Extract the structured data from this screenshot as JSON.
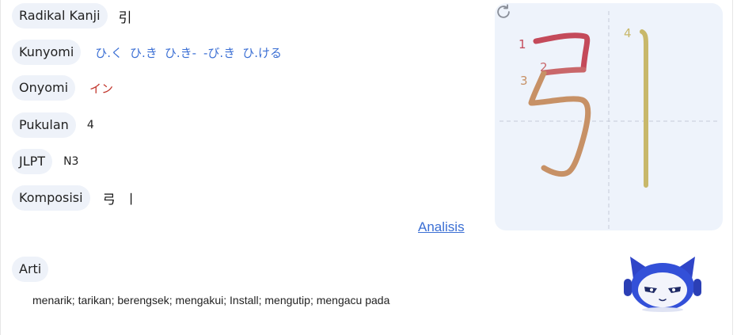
{
  "details": {
    "radical": {
      "label": "Radikal Kanji",
      "value": "引"
    },
    "kunyomi": {
      "label": "Kunyomi",
      "readings": [
        "ひ.く",
        "ひ.き",
        "ひ.き-",
        "-び.き",
        "ひ.ける"
      ]
    },
    "onyomi": {
      "label": "Onyomi",
      "value": "イン"
    },
    "strokes": {
      "label": "Pukulan",
      "value": "4"
    },
    "jlpt": {
      "label": "JLPT",
      "value": "N3"
    },
    "composition": {
      "label": "Komposisi",
      "parts": [
        "弓",
        "丨"
      ]
    }
  },
  "analysis_link": "Analisis",
  "meaning": {
    "label": "Arti",
    "text": "menarik; tarikan; berengsek; mengakui; Install; mengutip; mengacu pada"
  },
  "stroke_order": {
    "numbers": [
      "1",
      "2",
      "3",
      "4"
    ],
    "colors": {
      "stroke1": "#c44a5a",
      "stroke2": "#c9676a",
      "stroke3": "#c79166",
      "stroke4": "#c8b86a"
    },
    "replay_icon": "refresh-icon"
  },
  "colors": {
    "link": "#3b6fd4",
    "onyomi": "#c1352b",
    "pill_bg": "#eef2f9",
    "panel_bg": "#eef3fb"
  }
}
